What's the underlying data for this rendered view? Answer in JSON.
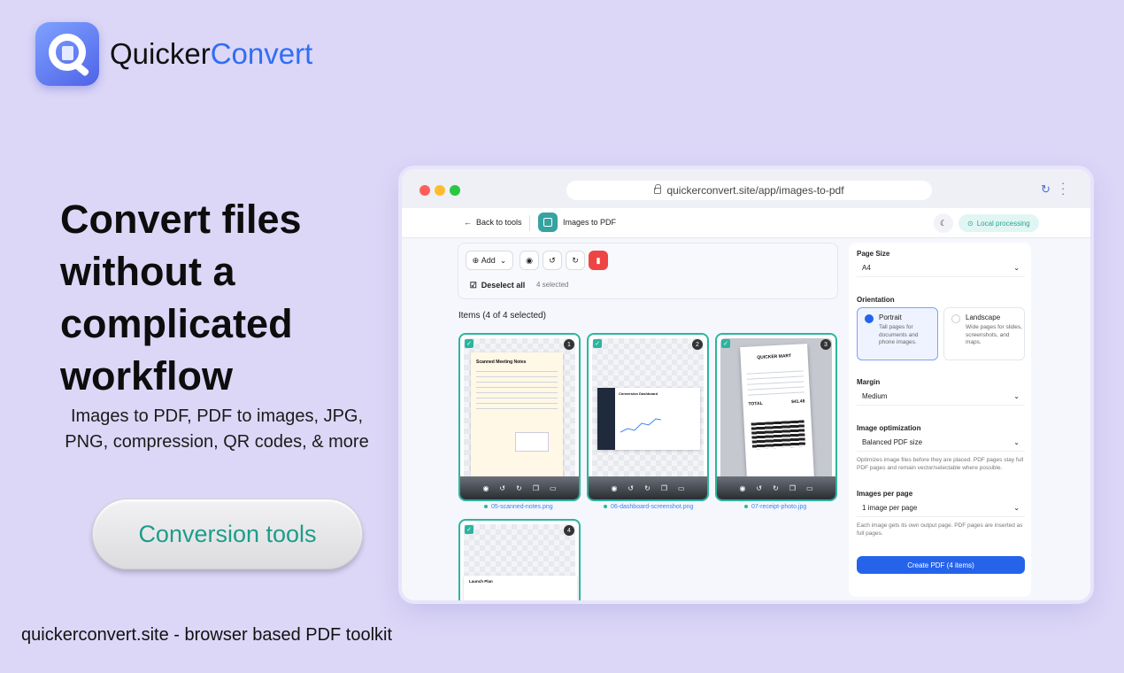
{
  "brand": {
    "name_part1": "Quicker",
    "name_part2": "Convert"
  },
  "hero": {
    "headline": "Convert files without a complicated workflow",
    "subtitle": "Images to PDF, PDF to images, JPG, PNG, compression, QR codes, & more",
    "cta_label": "Conversion tools"
  },
  "footer": {
    "text": "quickerconvert.site - browser based PDF toolkit"
  },
  "browser": {
    "url": "quickerconvert.site/app/images-to-pdf"
  },
  "app": {
    "back_label": "Back to tools",
    "tool_title": "Images to PDF",
    "local_label": "Local processing",
    "toolbar": {
      "add_label": "Add",
      "deselect_label": "Deselect all",
      "selected_count": "4 selected"
    },
    "items_title": "Items (4 of 4 selected)",
    "items": [
      {
        "index": "1",
        "file": "05-scanned-notes.png",
        "preview_title": "Scanned Meeting Notes"
      },
      {
        "index": "2",
        "file": "06-dashboard-screenshot.png",
        "preview_title": "Conversion Dashboard"
      },
      {
        "index": "3",
        "file": "07-receipt-photo.jpg",
        "preview_title": "QUICKER MART",
        "total_label": "TOTAL",
        "total_value": "$41.48"
      },
      {
        "index": "4",
        "file": "",
        "preview_title": "Launch Plan"
      }
    ],
    "settings": {
      "page_size_label": "Page Size",
      "page_size_value": "A4",
      "orientation_label": "Orientation",
      "portrait": {
        "title": "Portrait",
        "desc": "Tall pages for documents and phone images."
      },
      "landscape": {
        "title": "Landscape",
        "desc": "Wide pages for slides, screenshots, and maps."
      },
      "margin_label": "Margin",
      "margin_value": "Medium",
      "optimization_label": "Image optimization",
      "optimization_value": "Balanced PDF size",
      "optimization_help": "Optimizes image files before they are placed. PDF pages stay full PDF pages and remain vector/selectable where possible.",
      "per_page_label": "Images per page",
      "per_page_value": "1 image per page",
      "per_page_help": "Each image gets its own output page. PDF pages are inserted as full pages.",
      "create_label": "Create PDF (4 items)"
    }
  },
  "colors": {
    "background": "#dcd7f7",
    "accent": "#2563eb",
    "teal": "#2bb5a0",
    "brand_blue": "#2f6ef6"
  }
}
